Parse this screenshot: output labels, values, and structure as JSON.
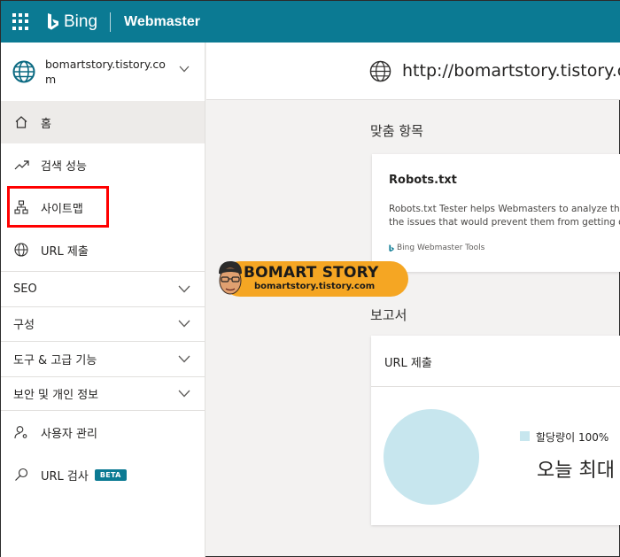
{
  "topbar": {
    "app_launcher_icon": "waffle-grid-icon",
    "brand": "Bing",
    "product": "Webmaster",
    "accent_color": "#0b7a93"
  },
  "sidebar": {
    "site": "bomartstory.tistory.com",
    "items": [
      {
        "label": "홈",
        "icon": "home-icon",
        "active": true
      },
      {
        "label": "검색 성능",
        "icon": "trend-up-icon"
      },
      {
        "label": "사이트맵",
        "icon": "sitemap-icon"
      },
      {
        "label": "URL 제출",
        "icon": "globe-icon"
      }
    ],
    "sections": [
      {
        "label": "SEO"
      },
      {
        "label": "구성"
      },
      {
        "label": "도구 & 고급 기능"
      },
      {
        "label": "보안 및 개인 정보"
      }
    ],
    "footer_items": [
      {
        "label": "사용자 관리",
        "icon": "user-settings-icon"
      },
      {
        "label": "URL 검사",
        "icon": "search-icon",
        "badge": "BETA"
      }
    ]
  },
  "main": {
    "site_url": "http://bomartstory.tistory.com",
    "recommended_title": "맞춤 항목",
    "recommended_card": {
      "title": "Robots.txt",
      "desc_line1": "Robots.txt Tester helps Webmasters to analyze the",
      "desc_line2": "the issues that would prevent them from getting o",
      "source": "Bing Webmaster Tools"
    },
    "reports_title": "보고서",
    "report_card": {
      "title": "URL 제출",
      "legend": "할당량이 100%",
      "big_text": "오늘 최대",
      "chart_color": "#c7e6ee",
      "quota_percent": 100
    }
  },
  "watermark": {
    "title": "BOMART STORY",
    "subtitle": "bomartstory.tistory.com"
  }
}
